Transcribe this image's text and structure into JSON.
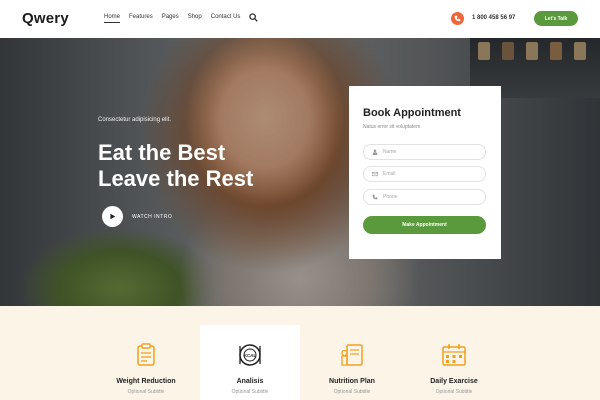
{
  "header": {
    "logo": "Qwery",
    "nav": [
      "Home",
      "Features",
      "Pages",
      "Shop",
      "Contact Us"
    ],
    "search_icon": "search-icon",
    "phone_icon": "phone-icon",
    "phone": "1 800 458 56 97",
    "cta": "Let's Talk"
  },
  "hero": {
    "eyebrow": "Consectetur adipisicing elit.",
    "headline_line1": "Eat the Best",
    "headline_line2": "Leave the Rest",
    "watch": "WATCH INTRO"
  },
  "appointment": {
    "title": "Book Appointment",
    "subtitle": "Natus error sit voluptatem",
    "name_placeholder": "Name",
    "email_placeholder": "Email",
    "phone_placeholder": "Phone",
    "button": "Make Appointment"
  },
  "features": [
    {
      "title": "Weight Reduction",
      "subtitle": "Optional Subtitle",
      "icon": "clipboard-icon"
    },
    {
      "title": "Analisis",
      "subtitle": "Optional Subtitle",
      "icon": "kcal-icon"
    },
    {
      "title": "Nutrition Plan",
      "subtitle": "Optional Subtitle",
      "icon": "nutrition-icon"
    },
    {
      "title": "Daily Exarcise",
      "subtitle": "Optional Subtitle",
      "icon": "calendar-icon"
    }
  ],
  "colors": {
    "accent_green": "#5a9a3d",
    "accent_orange": "#f0663a",
    "feature_icon": "#f0a020",
    "features_bg": "#fdf4e8"
  }
}
